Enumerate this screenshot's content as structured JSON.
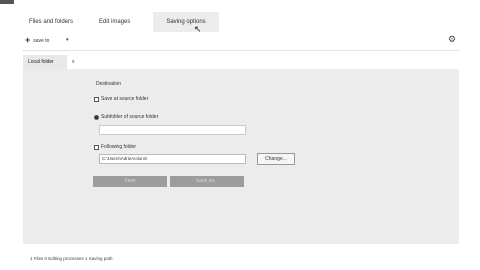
{
  "app": {
    "title_snippet": ""
  },
  "tabs": [
    {
      "label": "Files and folders"
    },
    {
      "label": "Edit images"
    },
    {
      "label": "Saving options"
    }
  ],
  "toolbar": {
    "save_label": "save to",
    "plus_icon": "plus-icon",
    "caret": "▾",
    "gear": "⚙"
  },
  "subtab": {
    "label": "Local folder",
    "close": "x"
  },
  "panel": {
    "destination_label": "Destination",
    "options": [
      {
        "label": "Save at source folder",
        "checked": false
      },
      {
        "label": "Subfolder of source folder",
        "checked": true
      },
      {
        "label": "Following folder",
        "checked": false
      }
    ],
    "subfolder_value": "",
    "path_value": "C:\\Users\\AdrieActions\\",
    "change_label": "Change...",
    "save_button": "Save",
    "save_as_button": "Save as..."
  },
  "status": {
    "text": "1  Files   0  Editing processes   1  Saving path"
  },
  "colors": {
    "panel_bg": "#ececec",
    "button_disabled": "#9c9c9c"
  }
}
